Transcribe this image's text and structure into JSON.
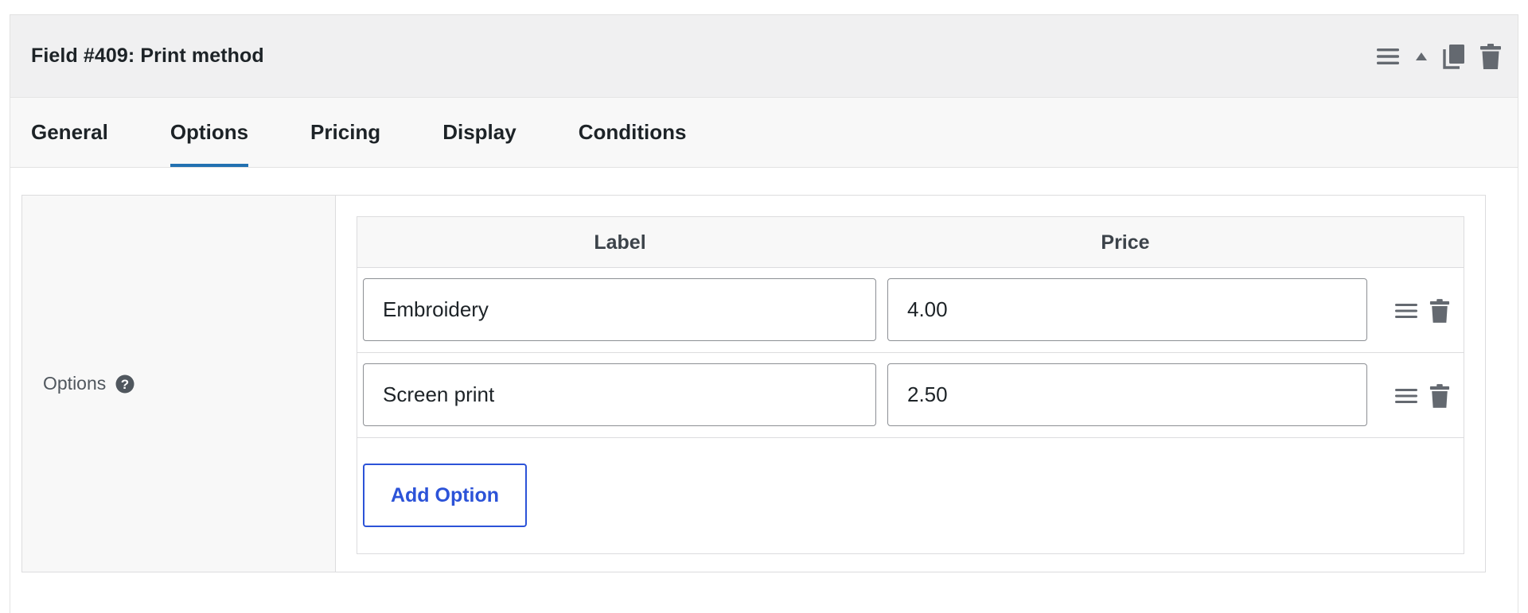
{
  "header": {
    "title": "Field #409: Print method",
    "icons": [
      "menu-icon",
      "arrow-up-icon",
      "copy-icon",
      "trash-icon"
    ]
  },
  "tabs": [
    {
      "label": "General",
      "active": false
    },
    {
      "label": "Options",
      "active": true
    },
    {
      "label": "Pricing",
      "active": false
    },
    {
      "label": "Display",
      "active": false
    },
    {
      "label": "Conditions",
      "active": false
    }
  ],
  "options_setting": {
    "label": "Options",
    "help_icon": "question-icon",
    "columns": {
      "label": "Label",
      "price": "Price"
    },
    "rows": [
      {
        "label": "Embroidery",
        "price": "4.00"
      },
      {
        "label": "Screen print",
        "price": "2.50"
      }
    ],
    "add_button_label": "Add Option"
  },
  "colors": {
    "accent_blue": "#2271b1",
    "button_blue": "#2c53d8",
    "icon_gray": "#646970"
  }
}
